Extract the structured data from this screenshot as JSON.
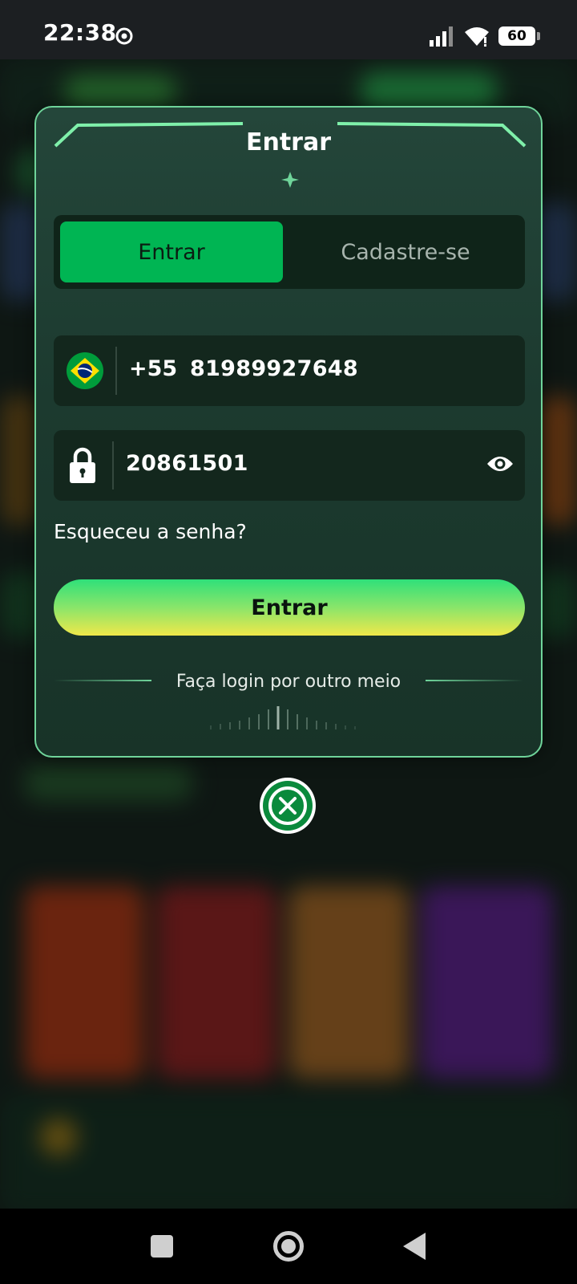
{
  "status_bar": {
    "time": "22:38",
    "battery": "60",
    "icons": [
      "chrome-icon",
      "signal-icon",
      "wifi-icon",
      "battery-icon"
    ]
  },
  "modal": {
    "title": "Entrar",
    "tabs": [
      {
        "label": "Entrar",
        "active": true
      },
      {
        "label": "Cadastre-se",
        "active": false
      }
    ],
    "phone": {
      "country_flag": "brazil-flag-icon",
      "dial_code": "+55",
      "value": "81989927648"
    },
    "password": {
      "value": "20861501",
      "lock_icon": "lock-icon",
      "toggle_icon": "eye-icon"
    },
    "forgot_label": "Esqueceu a senha?",
    "submit_label": "Entrar",
    "alt_login_label": "Faça login por outro meio",
    "close_icon": "close-icon"
  },
  "nav_bar": {
    "icons": [
      "recents-icon",
      "home-icon",
      "back-icon"
    ]
  },
  "colors": {
    "accent": "#00b553",
    "border": "#6fd49a",
    "modal_bg": "#1c3a2f",
    "submit_gradient_top": "#2fe07a",
    "submit_gradient_bottom": "#f0e84a"
  }
}
